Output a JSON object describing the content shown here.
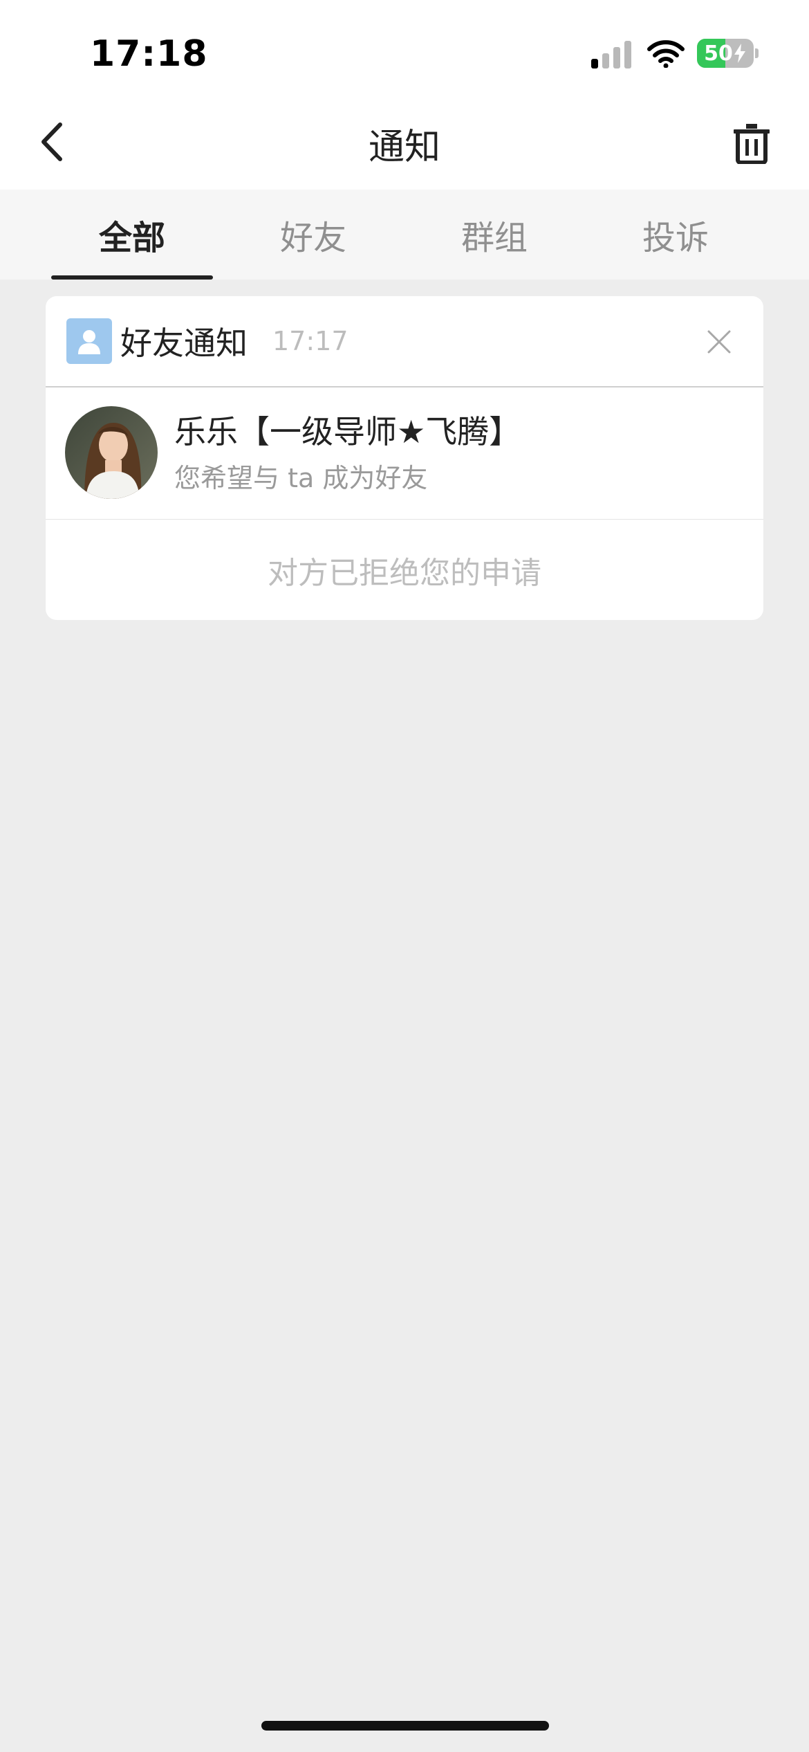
{
  "status_bar": {
    "time": "17:18",
    "battery_level": "50",
    "icons": [
      "cellular-signal-icon",
      "wifi-icon",
      "battery-charging-icon"
    ]
  },
  "nav": {
    "title": "通知",
    "back_icon": "chevron-left-icon",
    "trash_icon": "trash-icon"
  },
  "tabs": [
    {
      "label": "全部",
      "active": true
    },
    {
      "label": "好友",
      "active": false
    },
    {
      "label": "群组",
      "active": false
    },
    {
      "label": "投诉",
      "active": false
    }
  ],
  "notification": {
    "type_label": "好友通知",
    "type_icon": "person-icon",
    "time": "17:17",
    "close_icon": "close-icon",
    "user_name": "乐乐【一级导师★飞腾】",
    "message": "您希望与 ta 成为好友",
    "status": "对方已拒绝您的申请"
  },
  "colors": {
    "background": "#ededed",
    "card": "#ffffff",
    "battery_green": "#34c759",
    "friend_icon_blue": "#9ec8ee"
  }
}
